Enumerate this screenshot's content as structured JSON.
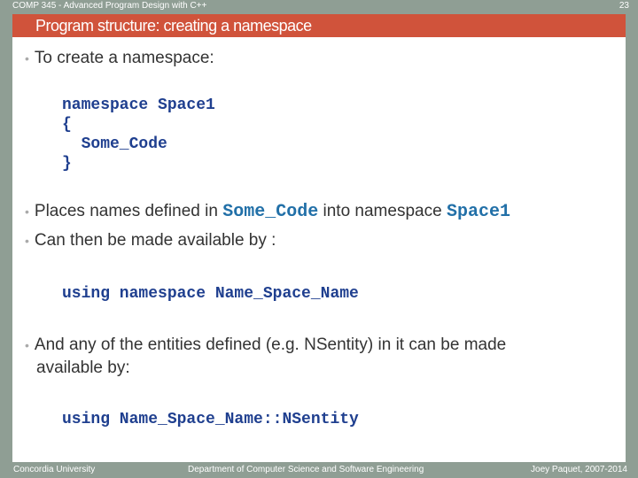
{
  "header": {
    "course": "COMP 345 - Advanced Program Design with C++",
    "page": "23",
    "title": "Program structure: creating a namespace"
  },
  "body": {
    "b1": "To create a namespace:",
    "code1": [
      "namespace Space1",
      "{",
      "  Some_Code",
      "}"
    ],
    "b2_pre": "Places names defined in ",
    "b2_code1": "Some_Code",
    "b2_mid": " into namespace ",
    "b2_code2": "Space1",
    "b3": "Can then be made available by :",
    "code2": "using namespace Name_Space_Name",
    "b4_l1": "And any of the entities defined (e.g. NSentity) in it can be made",
    "b4_l2": "available by:",
    "code3": "using Name_Space_Name::NSentity"
  },
  "footer": {
    "left": "Concordia University",
    "center": "Department of Computer Science and Software Engineering",
    "right": "Joey Paquet, 2007-2014"
  }
}
